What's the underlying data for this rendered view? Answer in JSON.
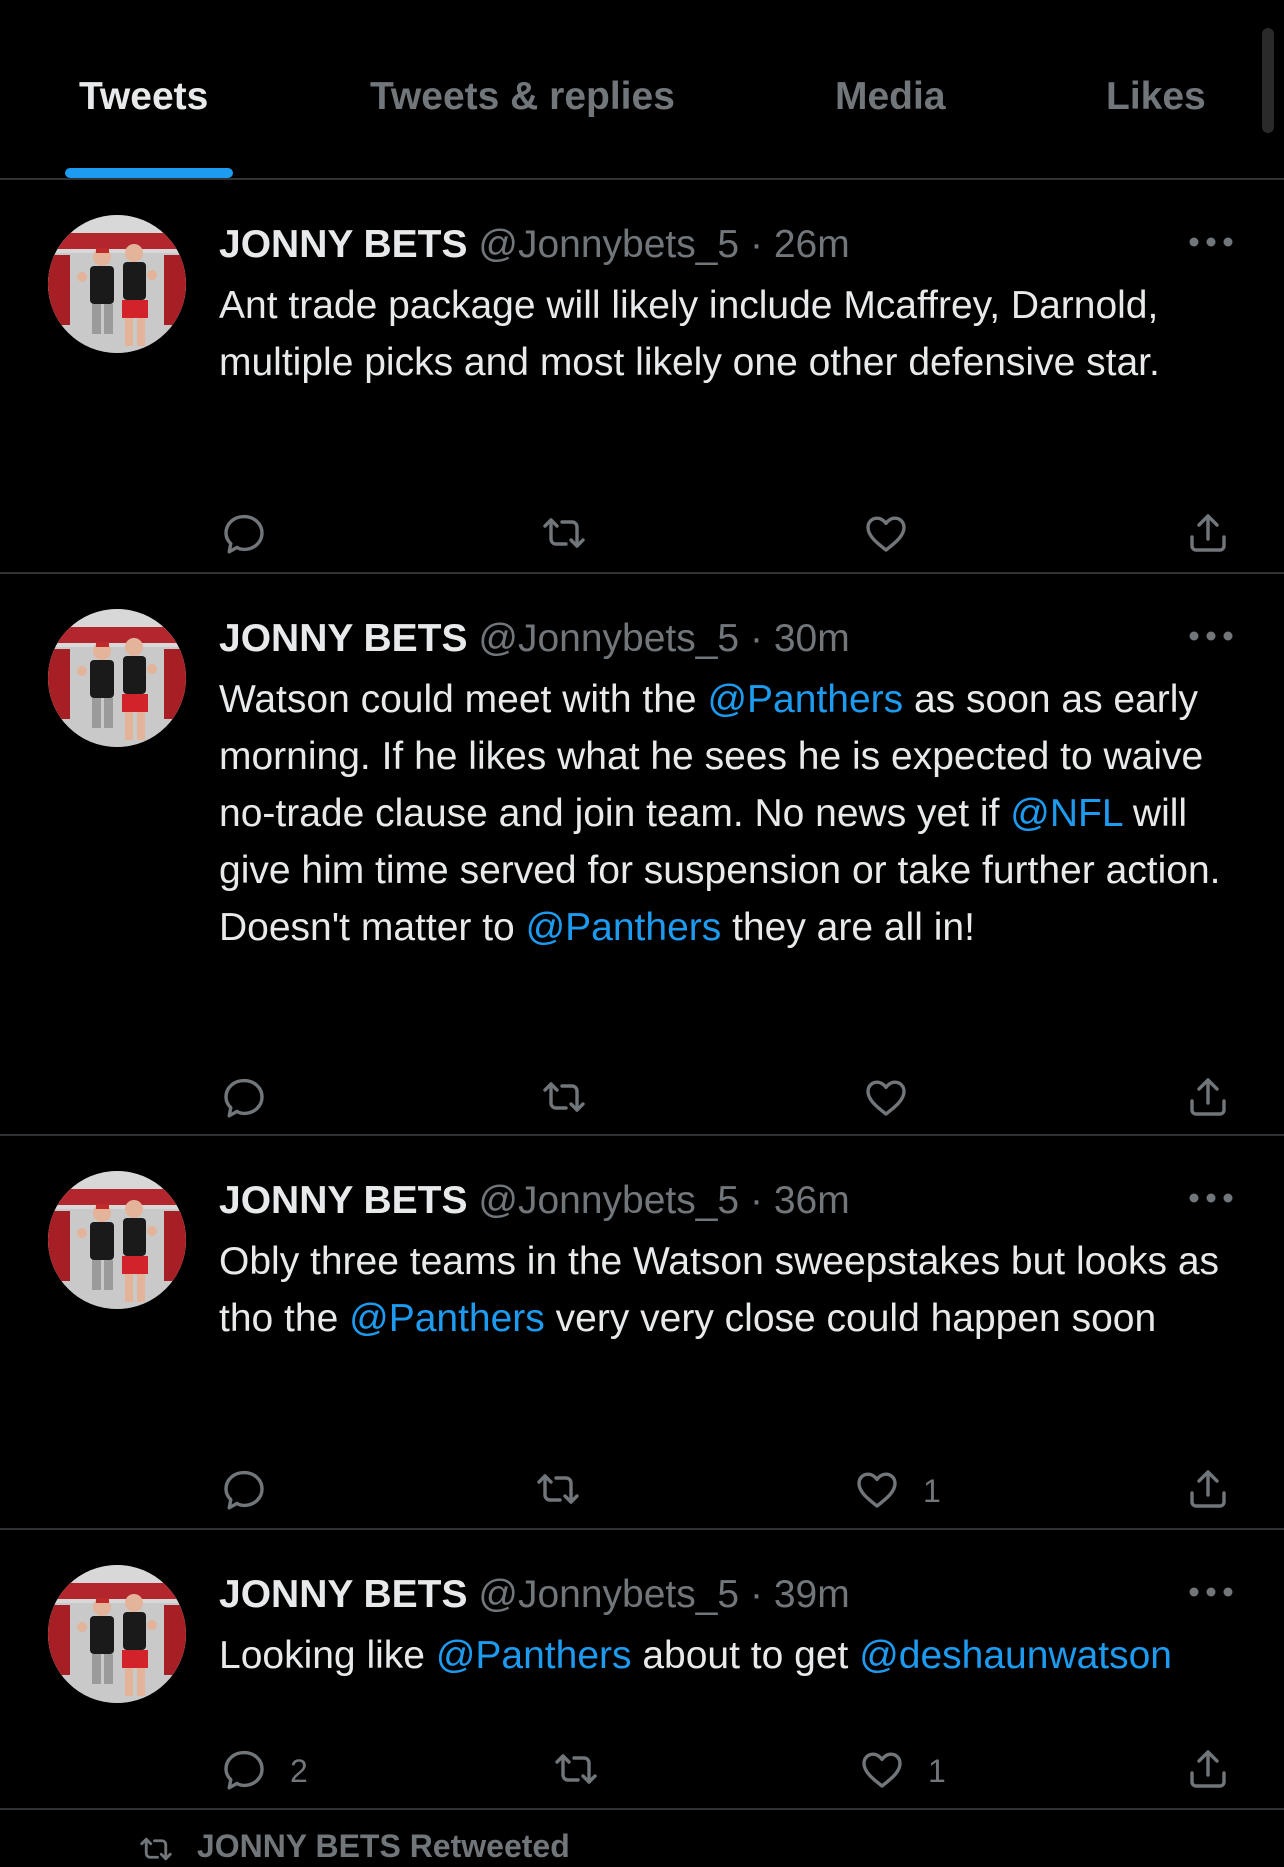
{
  "tabs": [
    {
      "label": "Tweets"
    },
    {
      "label": "Tweets & replies"
    },
    {
      "label": "Media"
    },
    {
      "label": "Likes"
    }
  ],
  "tweets": [
    {
      "name": "JONNY BETS",
      "handle": "@Jonnybets_5",
      "separator": "·",
      "time": "26m",
      "text": [
        {
          "t": "Ant trade package will likely include Mcaffrey, Darnold, multiple picks and most likely one other defensive star."
        }
      ],
      "replies": "",
      "likes": ""
    },
    {
      "name": "JONNY BETS",
      "handle": "@Jonnybets_5",
      "separator": "·",
      "time": "30m",
      "text": [
        {
          "t": "Watson could meet with the "
        },
        {
          "t": "@Panthers",
          "mention": true
        },
        {
          "t": " as soon as early morning. If he likes what he sees he is expected to waive no-trade clause and join team. No news yet if "
        },
        {
          "t": "@NFL",
          "mention": true
        },
        {
          "t": " will give him time served for suspension or take further action. Doesn't matter to "
        },
        {
          "t": "@Panthers",
          "mention": true
        },
        {
          "t": " they are all in!"
        }
      ],
      "replies": "",
      "likes": ""
    },
    {
      "name": "JONNY BETS",
      "handle": "@Jonnybets_5",
      "separator": "·",
      "time": "36m",
      "text": [
        {
          "t": "Obly three teams in the Watson sweepstakes but looks as tho the "
        },
        {
          "t": "@Panthers",
          "mention": true
        },
        {
          "t": " very very close could happen soon"
        }
      ],
      "replies": "",
      "likes": "1"
    },
    {
      "name": "JONNY BETS",
      "handle": "@Jonnybets_5",
      "separator": "·",
      "time": "39m",
      "text": [
        {
          "t": "Looking like "
        },
        {
          "t": "@Panthers",
          "mention": true
        },
        {
          "t": " about to get "
        },
        {
          "t": "@deshaunwatson",
          "mention": true
        }
      ],
      "replies": "2",
      "likes": "1"
    }
  ],
  "retweeted_label": "JONNY BETS Retweeted",
  "icons": {
    "reply": "reply-icon",
    "retweet": "retweet-icon",
    "like": "heart-icon",
    "share": "share-icon",
    "more": "more-icon"
  },
  "colors": {
    "background": "#000000",
    "accent": "#1d9bf0",
    "text": "#e7e9ea",
    "muted": "#71767b",
    "divider": "#2f3336"
  }
}
